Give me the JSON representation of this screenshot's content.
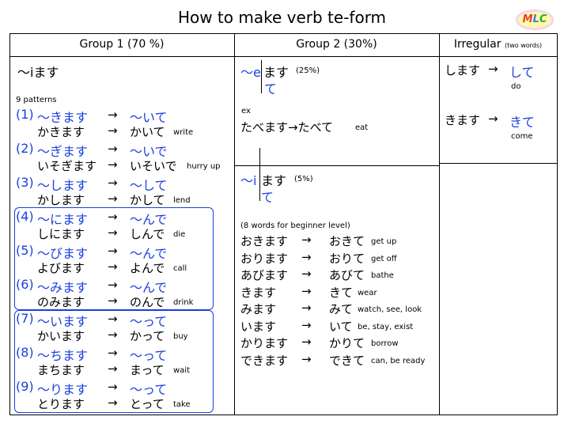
{
  "title": "How to make verb te-form",
  "logo": "MLC",
  "headers": {
    "group1": "Group 1 (70 %)",
    "group2": "Group 2 (30%)",
    "irregular": "Irregular",
    "irregular_note": "(two words)"
  },
  "group1": {
    "masu": "〜iます",
    "patterns_label": "9 patterns",
    "items": [
      {
        "num": "(1)",
        "rule_from": "〜きます",
        "rule_to": "〜いて",
        "ex_from": "かきます",
        "ex_to": "かいて",
        "meaning": "write"
      },
      {
        "num": "(2)",
        "rule_from": "〜ぎます",
        "rule_to": "〜いで",
        "ex_from": "いそぎます",
        "ex_to": "いそいで",
        "meaning": "hurry up"
      },
      {
        "num": "(3)",
        "rule_from": "〜します",
        "rule_to": "〜して",
        "ex_from": "かします",
        "ex_to": "かして",
        "meaning": "lend"
      },
      {
        "num": "(4)",
        "rule_from": "〜にます",
        "rule_to": "〜んで",
        "ex_from": "しにます",
        "ex_to": "しんで",
        "meaning": "die"
      },
      {
        "num": "(5)",
        "rule_from": "〜びます",
        "rule_to": "〜んで",
        "ex_from": "よびます",
        "ex_to": "よんで",
        "meaning": "call"
      },
      {
        "num": "(6)",
        "rule_from": "〜みます",
        "rule_to": "〜んで",
        "ex_from": "のみます",
        "ex_to": "のんで",
        "meaning": "drink"
      },
      {
        "num": "(7)",
        "rule_from": "〜います",
        "rule_to": "〜って",
        "ex_from": "かいます",
        "ex_to": "かって",
        "meaning": "buy"
      },
      {
        "num": "(8)",
        "rule_from": "〜ちます",
        "rule_to": "〜って",
        "ex_from": "まちます",
        "ex_to": "まって",
        "meaning": "wait"
      },
      {
        "num": "(9)",
        "rule_from": "〜ります",
        "rule_to": "〜って",
        "ex_from": "とります",
        "ex_to": "とって",
        "meaning": "take"
      }
    ]
  },
  "group2": {
    "e_prefix": "〜e",
    "e_masu": "ます",
    "e_te": "て",
    "e_percent": "(25%)",
    "ex_label": "ex",
    "ex_text": "たべます→たべて",
    "ex_meaning": "eat",
    "i_prefix": "〜i",
    "i_masu": "ます",
    "i_te": "て",
    "i_percent": "(5%)",
    "words_label": "(8 words for beginner level)",
    "words": [
      {
        "from": "おきます",
        "to": "おきて",
        "meaning": "get up"
      },
      {
        "from": "おります",
        "to": "おりて",
        "meaning": "get off"
      },
      {
        "from": "あびます",
        "to": "あびて",
        "meaning": "bathe"
      },
      {
        "from": "きます",
        "to": "きて",
        "meaning": "wear"
      },
      {
        "from": "みます",
        "to": "みて",
        "meaning": "watch, see, look"
      },
      {
        "from": "います",
        "to": "いて",
        "meaning": "be, stay, exist"
      },
      {
        "from": "かります",
        "to": "かりて",
        "meaning": "borrow"
      },
      {
        "from": "できます",
        "to": "できて",
        "meaning": "can, be ready"
      }
    ]
  },
  "irregular": [
    {
      "from": "します",
      "to": "して",
      "meaning": "do"
    },
    {
      "from": "きます",
      "to": "きて",
      "meaning": "come"
    }
  ],
  "arrow": "→"
}
